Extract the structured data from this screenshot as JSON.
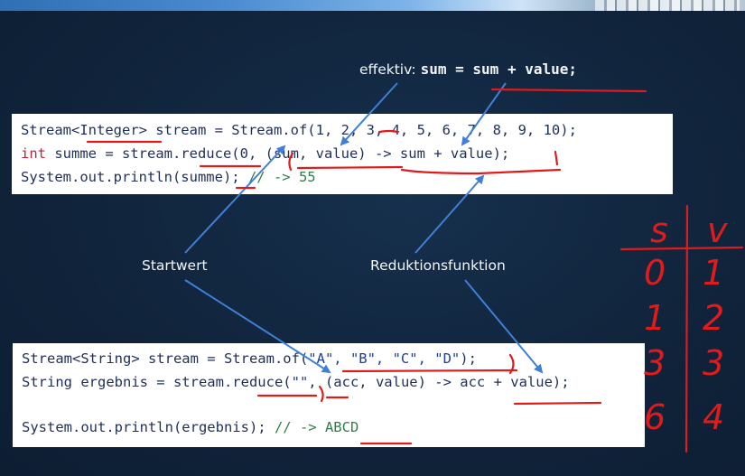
{
  "caption_effective": {
    "label": "effektiv:",
    "code": "sum = sum + value;"
  },
  "caption_startwert": "Startwert",
  "caption_reduktion": "Reduktionsfunktion",
  "example1": {
    "line1": {
      "a": "Stream<Integer> stream = Stream.of(1, 2, 3, 4, 5, 6, 7, 8, 9, 10);"
    },
    "line2": {
      "kw": "int",
      "rest": " summe = stream.reduce(0, (sum, value) -> sum + value);"
    },
    "line3": {
      "code": "System.out.println(summe); ",
      "comment": "// -> 55"
    }
  },
  "example2": {
    "line1": {
      "a": "Stream<String> stream = Stream.of(",
      "strings": "\"A\", \"B\", \"C\", \"D\"",
      "b": ");"
    },
    "line2": {
      "a": "String ergebnis = stream.reduce(",
      "str": "\"\"",
      "b": ", (acc, value) -> acc + value);"
    },
    "line3": {
      "code": "System.out.println(ergebnis); ",
      "comment": "// -> ABCD"
    }
  },
  "annotation_table": {
    "headers": [
      "s",
      "v"
    ],
    "rows": [
      [
        "0",
        "1"
      ],
      [
        "1",
        "2"
      ],
      [
        "3",
        "3"
      ],
      [
        "6",
        "4"
      ]
    ]
  },
  "colors": {
    "background": "#10233a",
    "annotation": "#e01b1b",
    "arrows": "#3f7fd8"
  }
}
